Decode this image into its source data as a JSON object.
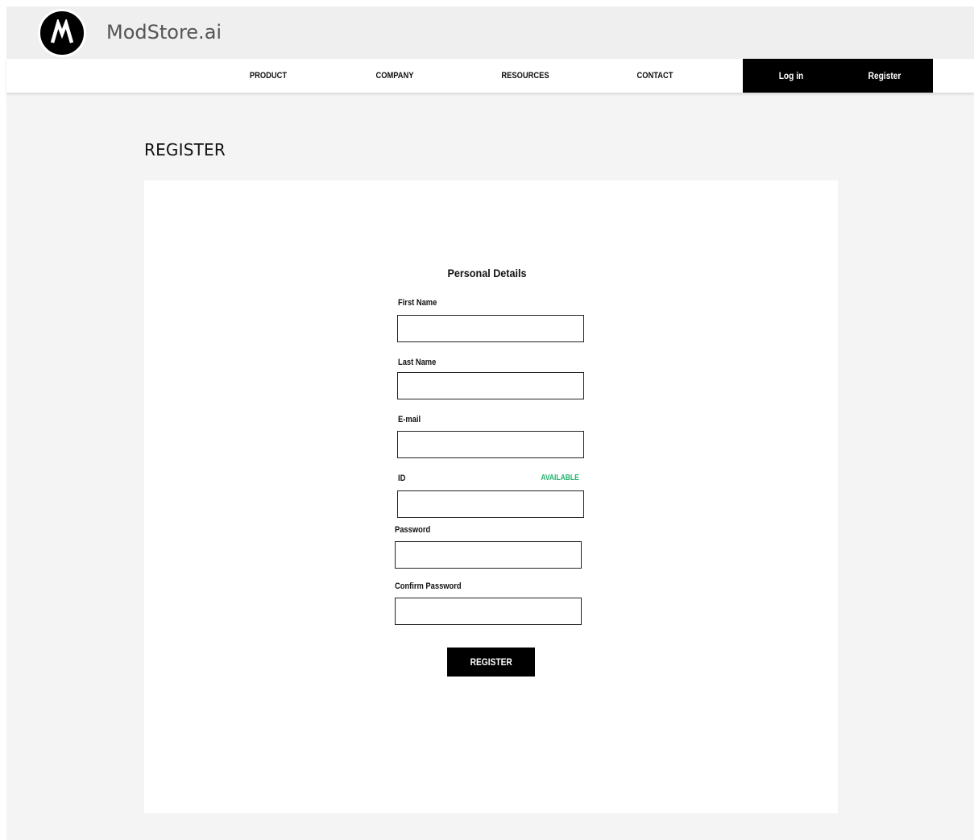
{
  "brand": {
    "name": "ModStore.ai",
    "logo_letter": "M"
  },
  "nav": {
    "items": [
      "PRODUCT",
      "COMPANY",
      "RESOURCES",
      "CONTACT"
    ],
    "login": "Log in",
    "register": "Register"
  },
  "page": {
    "title": "REGISTER"
  },
  "form": {
    "section_title": "Personal Details",
    "first_name_label": "First Name",
    "last_name_label": "Last Name",
    "email_label": "E-mail",
    "id_label": "ID",
    "id_status": "AVAILABLE",
    "password_label": "Password",
    "confirm_password_label": "Confirm Password",
    "submit_label": "REGISTER"
  },
  "colors": {
    "available": "#1db36b",
    "accent": "#000000"
  }
}
